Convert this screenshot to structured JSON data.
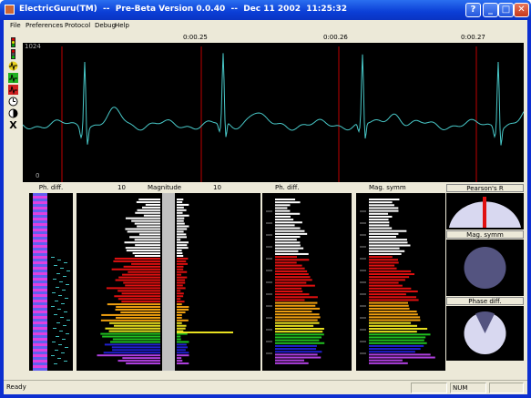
{
  "window": {
    "title": "ElectricGuru(TM)  --  Pre-Beta Version 0.0.40  --  Dec 11 2002  11:25:32",
    "controls": {
      "help": "?",
      "minimize": "_",
      "maximize": "□",
      "close": "✕"
    }
  },
  "menu": [
    "File",
    "Preferences",
    "Protocol",
    "Debug",
    "Help"
  ],
  "toolbar": {
    "icons": [
      "traffic-light-icon",
      "traffic-light-icon",
      "waveform-icon",
      "green-waveform-icon",
      "red-waveform-icon",
      "clock-icon",
      "half-moon-icon",
      "x-icon"
    ],
    "x_label": "X"
  },
  "ecg": {
    "time_labels": [
      "0:00.25",
      "0:00.26",
      "0:00.27"
    ],
    "y_max": "1024",
    "y_min": "0",
    "trace_color": "#48c8c8",
    "marker_color": "#c00000"
  },
  "panels": {
    "ph_diff_left": "Ph. diff.",
    "magnitude_left_tick": "10",
    "magnitude_title": "Magnitude",
    "magnitude_right_tick": "10",
    "ph_diff_mid": "Ph. diff.",
    "mag_symm": "Mag. symm",
    "pearson": "Pearson's R",
    "mag_symm_gauge": "Mag. symm",
    "phase_diff_gauge": "Phase diff."
  },
  "status": {
    "text": "Ready",
    "num": "NUM"
  }
}
